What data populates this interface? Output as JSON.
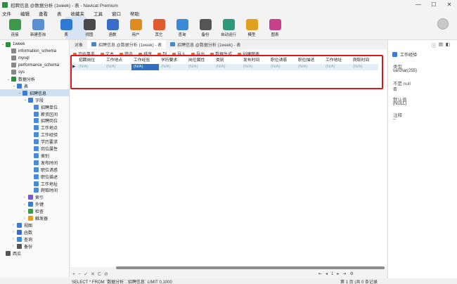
{
  "window": {
    "title": "招聘信息 @数据分析 (1week) - 表 - Navicat Premium",
    "controls": [
      "—",
      "☐",
      "✕"
    ]
  },
  "menu": [
    "文件",
    "编辑",
    "查看",
    "表",
    "收藏夹",
    "工具",
    "窗口",
    "帮助"
  ],
  "toolbar": [
    {
      "label": "连接",
      "icon": "connection-icon",
      "color": "#3a9a4a"
    },
    {
      "label": "新建查询",
      "icon": "new-query-icon",
      "color": "#5b8fd1"
    },
    {
      "label": "表",
      "icon": "table-icon",
      "color": "#2f7bd3"
    },
    {
      "label": "视图",
      "icon": "view-icon",
      "color": "#4a4a4a"
    },
    {
      "label": "函数",
      "icon": "function-icon",
      "color": "#3a6cc8"
    },
    {
      "label": "用户",
      "icon": "user-icon",
      "color": "#e08a20"
    },
    {
      "label": "其它",
      "icon": "other-icon",
      "color": "#e05a30"
    },
    {
      "label": "查询",
      "icon": "query-icon",
      "color": "#3a8ad8"
    },
    {
      "label": "备份",
      "icon": "backup-icon",
      "color": "#555555"
    },
    {
      "label": "自动运行",
      "icon": "automation-icon",
      "color": "#2a9a7a"
    },
    {
      "label": "模型",
      "icon": "model-icon",
      "color": "#e0a020"
    },
    {
      "label": "图表",
      "icon": "chart-icon",
      "color": "#c8408a"
    }
  ],
  "tree": [
    {
      "label": "1week",
      "level": 0,
      "icon": "connection-icon",
      "color": "#2f8d3e",
      "expanded": "open"
    },
    {
      "label": "information_schema",
      "level": 1,
      "icon": "database-icon",
      "color": "#888888"
    },
    {
      "label": "mysql",
      "level": 1,
      "icon": "database-icon",
      "color": "#888888"
    },
    {
      "label": "performance_schema",
      "level": 1,
      "icon": "database-icon",
      "color": "#888888"
    },
    {
      "label": "sys",
      "level": 1,
      "icon": "database-icon",
      "color": "#888888"
    },
    {
      "label": "数据分析",
      "level": 1,
      "icon": "database-icon",
      "color": "#2f8d3e",
      "expanded": "open"
    },
    {
      "label": "表",
      "level": 2,
      "icon": "table-folder-icon",
      "color": "#3a7bd5",
      "expanded": "open"
    },
    {
      "label": "招聘信息",
      "level": 3,
      "icon": "table-icon",
      "color": "#3a7bd5",
      "expanded": "open",
      "selected": true
    },
    {
      "label": "字段",
      "level": 4,
      "icon": "fields-folder-icon",
      "color": "#3a7bd5",
      "expanded": "open"
    },
    {
      "label": "招聘单位",
      "level": 5,
      "icon": "field-icon",
      "color": "#4a8ad8"
    },
    {
      "label": "薪资区间",
      "level": 5,
      "icon": "field-icon",
      "color": "#4a8ad8"
    },
    {
      "label": "招聘岗位",
      "level": 5,
      "icon": "field-icon",
      "color": "#4a8ad8"
    },
    {
      "label": "工作地点",
      "level": 5,
      "icon": "field-icon",
      "color": "#4a8ad8"
    },
    {
      "label": "工作经验",
      "level": 5,
      "icon": "field-icon",
      "color": "#4a8ad8"
    },
    {
      "label": "学历要求",
      "level": 5,
      "icon": "field-icon",
      "color": "#4a8ad8"
    },
    {
      "label": "岗位属性",
      "level": 5,
      "icon": "field-icon",
      "color": "#4a8ad8"
    },
    {
      "label": "类别",
      "level": 5,
      "icon": "field-icon",
      "color": "#4a8ad8"
    },
    {
      "label": "发布时间",
      "level": 5,
      "icon": "field-icon",
      "color": "#4a8ad8"
    },
    {
      "label": "职位诱惑",
      "level": 5,
      "icon": "field-icon",
      "color": "#4a8ad8"
    },
    {
      "label": "职位描述",
      "level": 5,
      "icon": "field-icon",
      "color": "#4a8ad8"
    },
    {
      "label": "工作地址",
      "level": 5,
      "icon": "field-icon",
      "color": "#4a8ad8"
    },
    {
      "label": "爬取时间",
      "level": 5,
      "icon": "field-icon",
      "color": "#4a8ad8"
    },
    {
      "label": "索引",
      "level": 4,
      "icon": "index-icon",
      "color": "#7a5ac8",
      "expanded": "closed"
    },
    {
      "label": "外键",
      "level": 4,
      "icon": "foreign-key-icon",
      "color": "#3a7bd5",
      "expanded": "closed"
    },
    {
      "label": "检查",
      "level": 4,
      "icon": "check-icon",
      "color": "#3a9a4a",
      "expanded": "closed"
    },
    {
      "label": "触发器",
      "level": 4,
      "icon": "trigger-icon",
      "color": "#e0a020",
      "expanded": "closed"
    },
    {
      "label": "视图",
      "level": 2,
      "icon": "view-icon",
      "color": "#3a7bd5",
      "expanded": "closed"
    },
    {
      "label": "函数",
      "level": 2,
      "icon": "function-icon",
      "color": "#3a6cc8",
      "expanded": "closed"
    },
    {
      "label": "查询",
      "level": 2,
      "icon": "query-icon",
      "color": "#3a8ad8",
      "expanded": "closed"
    },
    {
      "label": "备份",
      "level": 2,
      "icon": "backup-icon",
      "color": "#555555",
      "expanded": "closed"
    },
    {
      "label": "西瓜",
      "level": 0,
      "icon": "connection-icon",
      "color": "#555555"
    }
  ],
  "tabs": [
    {
      "label": "对象",
      "active": false
    },
    {
      "label": "招聘信息 @数据分析 (1week) - 表",
      "active": true
    },
    {
      "label": "招聘信息 @数据分析 (1week) - 表",
      "active": false
    }
  ],
  "data_toolbar": [
    "开始事务",
    "文本",
    "筛选",
    "排序",
    "列",
    "导入",
    "导出",
    "数据生成",
    "创建图表"
  ],
  "grid": {
    "columns": [
      "招聘岗位",
      "工作地点",
      "工作经验",
      "学历要求",
      "岗位属性",
      "类别",
      "发布时间",
      "职位诱惑",
      "职位描述",
      "工作地址",
      "爬取时间"
    ],
    "rows": [
      {
        "marker": "▶",
        "cells": [
          "(N/A)",
          "(N/A)",
          "(N/A)",
          "(N/A)",
          "(N/A)",
          "(N/A)",
          "(N/A)",
          "(N/A)",
          "(N/A)",
          "(N/A)",
          "(N/A)"
        ],
        "current_col": 2
      }
    ]
  },
  "bottombar": [
    "+",
    "−",
    "✓",
    "✕",
    "C",
    "⊘"
  ],
  "pager": {
    "first": "⇤",
    "prev": "◂",
    "page": "1",
    "next": "▸",
    "last": "⇥",
    "settings": "⚙"
  },
  "status": {
    "sql": "SELECT * FROM `数据分析`.`招聘信息` LIMIT 0,1000",
    "right": "第 1 页 (共 0 条记录"
  },
  "right_panel": {
    "title": "工作经验",
    "fields": [
      {
        "label": "类型",
        "value": "varchar(255)"
      },
      {
        "label": "不是 null",
        "value": "否"
      },
      {
        "label": "默认值",
        "value": "(NULL)"
      },
      {
        "label": "注释",
        "value": "--"
      }
    ]
  }
}
